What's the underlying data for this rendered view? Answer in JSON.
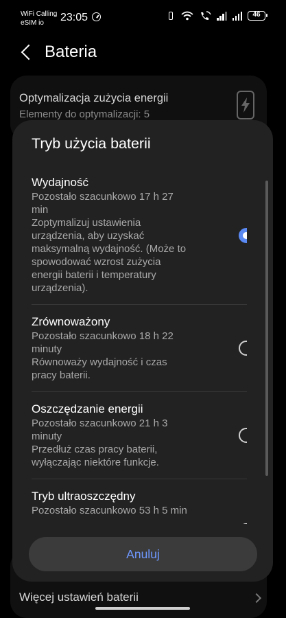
{
  "status_bar": {
    "carrier_line1": "WiFi Calling",
    "carrier_line2": "eSIM io",
    "time": "23:05",
    "battery": "46",
    "icons": [
      "timer-icon",
      "vibrate-icon",
      "wifi-icon",
      "wifi-calling-icon",
      "signal-icon",
      "signal-icon",
      "battery-icon"
    ]
  },
  "header": {
    "title": "Bateria",
    "back_icon": "chevron-left-icon"
  },
  "background": {
    "card1_title": "Optymalizacja zużycia energii",
    "card1_subtitle": "Elementy do optymalizacji: 5",
    "card1_icon": "battery-bolt-icon",
    "more_settings": "Więcej ustawień baterii"
  },
  "dialog": {
    "title": "Tryb użycia baterii",
    "options": [
      {
        "name": "Wydajność",
        "time": "Pozostało szacunkowo 17 h 27 min",
        "desc": "Zoptymalizuj ustawienia urządzenia, aby uzyskać maksymalną wydajność. (Może to spowodować wzrost zużycia energii baterii i temperatury urządzenia).",
        "selected": true
      },
      {
        "name": "Zrównoważony",
        "time": "Pozostało szacunkowo 18 h 22 minuty",
        "desc": "Równoważy wydajność i czas pracy baterii.",
        "selected": false
      },
      {
        "name": "Oszczędzanie energii",
        "time": "Pozostało szacunkowo 21 h 3 minuty",
        "desc": "Przedłuż czas pracy baterii, wyłączając niektóre funkcje.",
        "selected": false
      },
      {
        "name": "Tryb ultraoszczędny",
        "time": "Pozostało szacunkowo 53 h 5 min",
        "desc": "",
        "selected": false
      }
    ],
    "cancel_label": "Anuluj"
  },
  "colors": {
    "accent": "#5b8af5",
    "cancel_text": "#6f98ff",
    "dialog_bg": "#222222",
    "page_bg": "#000000"
  }
}
